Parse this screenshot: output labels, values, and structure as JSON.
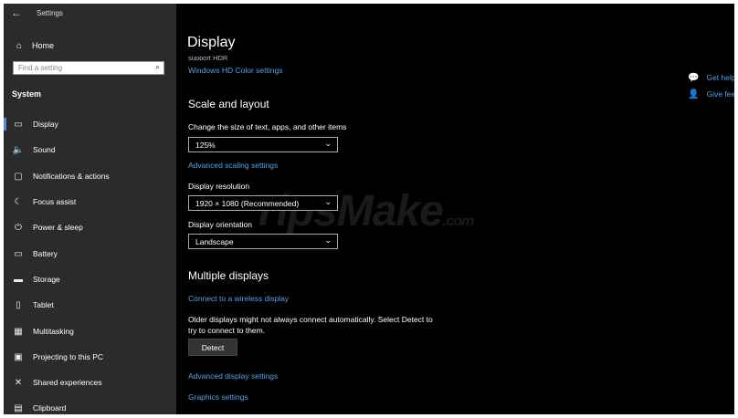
{
  "window": {
    "title": "Settings",
    "back_glyph": "←"
  },
  "sidebar": {
    "home": {
      "label": "Home",
      "icon": "home-icon",
      "glyph": "⌂"
    },
    "search": {
      "placeholder": "Find a setting",
      "icon_glyph": "⌕"
    },
    "group_label": "System",
    "items": [
      {
        "label": "Display",
        "icon": "monitor-icon",
        "glyph": "▭",
        "selected": true
      },
      {
        "label": "Sound",
        "icon": "speaker-icon",
        "glyph": "🔈"
      },
      {
        "label": "Notifications & actions",
        "icon": "notification-icon",
        "glyph": "▢"
      },
      {
        "label": "Focus assist",
        "icon": "moon-icon",
        "glyph": "☾"
      },
      {
        "label": "Power & sleep",
        "icon": "power-icon",
        "glyph": "⏻"
      },
      {
        "label": "Battery",
        "icon": "battery-icon",
        "glyph": "▭"
      },
      {
        "label": "Storage",
        "icon": "storage-icon",
        "glyph": "▬"
      },
      {
        "label": "Tablet",
        "icon": "tablet-icon",
        "glyph": "▯"
      },
      {
        "label": "Multitasking",
        "icon": "multitasking-icon",
        "glyph": "▦"
      },
      {
        "label": "Projecting to this PC",
        "icon": "projector-icon",
        "glyph": "▣"
      },
      {
        "label": "Shared experiences",
        "icon": "shared-icon",
        "glyph": "✕"
      },
      {
        "label": "Clipboard",
        "icon": "clipboard-icon",
        "glyph": "▤"
      }
    ]
  },
  "main": {
    "title": "Display",
    "cut_text": "support HDR",
    "hdr_link": "Windows HD Color settings",
    "scale_heading": "Scale and layout",
    "scale_label": "Change the size of text, apps, and other items",
    "scale_value": "125%",
    "advanced_scaling_link": "Advanced scaling settings",
    "resolution_label": "Display resolution",
    "resolution_value": "1920 × 1080 (Recommended)",
    "orientation_label": "Display orientation",
    "orientation_value": "Landscape",
    "multi_heading": "Multiple displays",
    "wireless_link": "Connect to a wireless display",
    "older_text_1": "Older displays might not always connect automatically. Select Detect to",
    "older_text_2": "try to connect to them.",
    "detect_button": "Detect",
    "advanced_display_link": "Advanced display settings",
    "graphics_link": "Graphics settings",
    "chevron": "⌄"
  },
  "side_links": {
    "get_help": {
      "label": "Get help",
      "icon": "help-chat-icon",
      "glyph": "💬"
    },
    "give_feedback": {
      "label": "Give feedback",
      "icon": "feedback-icon",
      "glyph": "👤"
    }
  },
  "watermark": {
    "text": "TipsMake",
    "suffix": ".com"
  }
}
